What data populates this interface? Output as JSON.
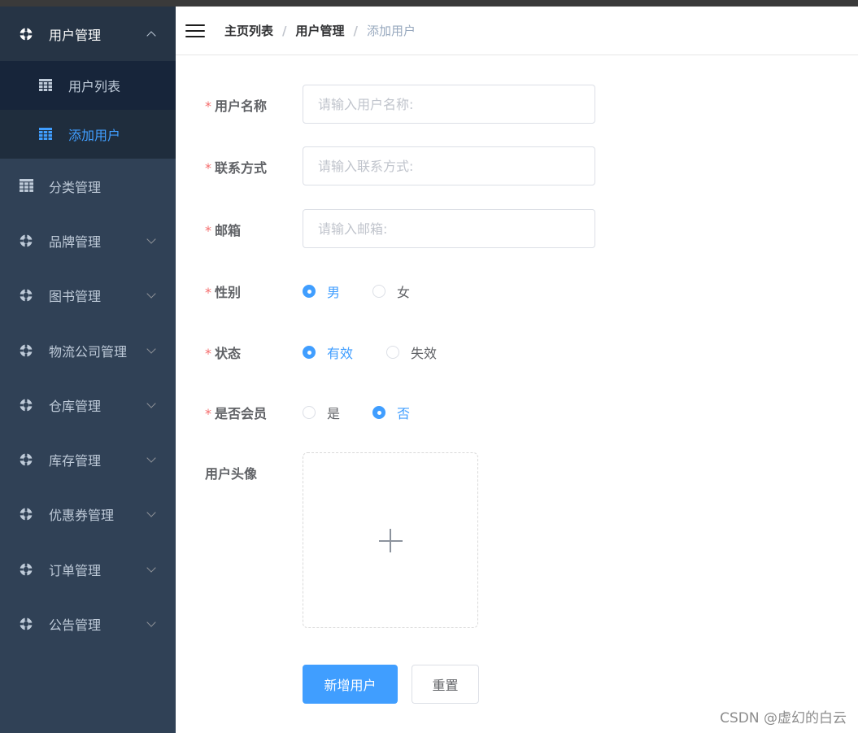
{
  "sidebar": {
    "open_menu": {
      "label": "用户管理",
      "icon": "lifebuoy-icon"
    },
    "sub_items": [
      {
        "label": "用户列表",
        "icon": "table-icon"
      },
      {
        "label": "添加用户",
        "icon": "table-icon",
        "active": true
      }
    ],
    "items": [
      {
        "label": "分类管理",
        "icon": "table-icon"
      },
      {
        "label": "品牌管理",
        "icon": "lifebuoy-icon"
      },
      {
        "label": "图书管理",
        "icon": "lifebuoy-icon"
      },
      {
        "label": "物流公司管理",
        "icon": "lifebuoy-icon"
      },
      {
        "label": "仓库管理",
        "icon": "lifebuoy-icon"
      },
      {
        "label": "库存管理",
        "icon": "lifebuoy-icon"
      },
      {
        "label": "优惠券管理",
        "icon": "lifebuoy-icon"
      },
      {
        "label": "订单管理",
        "icon": "lifebuoy-icon"
      },
      {
        "label": "公告管理",
        "icon": "lifebuoy-icon"
      }
    ]
  },
  "header": {
    "breadcrumb": [
      "主页列表",
      "用户管理",
      "添加用户"
    ],
    "separator": "/"
  },
  "form": {
    "username": {
      "label": "用户名称",
      "placeholder": "请输入用户名称:",
      "value": ""
    },
    "contact": {
      "label": "联系方式",
      "placeholder": "请输入联系方式:",
      "value": ""
    },
    "email": {
      "label": "邮箱",
      "placeholder": "请输入邮箱:",
      "value": ""
    },
    "gender": {
      "label": "性别",
      "options": [
        "男",
        "女"
      ],
      "selected": "男"
    },
    "status": {
      "label": "状态",
      "options": [
        "有效",
        "失效"
      ],
      "selected": "有效"
    },
    "member": {
      "label": "是否会员",
      "options": [
        "是",
        "否"
      ],
      "selected": "否"
    },
    "avatar": {
      "label": "用户头像"
    },
    "required_mark": "*",
    "submit_label": "新增用户",
    "reset_label": "重置"
  },
  "watermark": "CSDN @虚幻的白云",
  "colors": {
    "sidebar_bg": "#304156",
    "accent": "#409eff",
    "required": "#f56c6c"
  }
}
